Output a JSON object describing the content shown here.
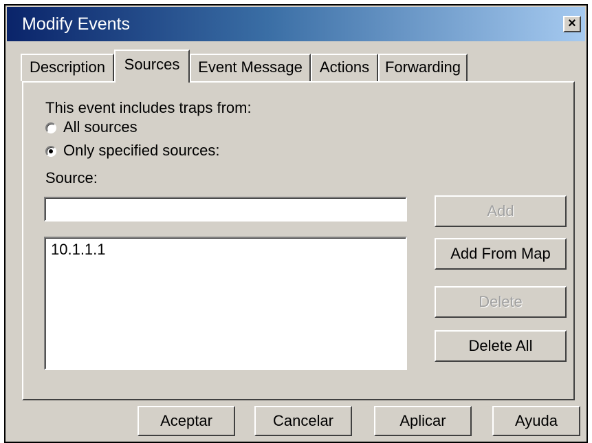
{
  "window": {
    "title": "Modify Events",
    "close_label": "×"
  },
  "tabs": [
    {
      "label": "Description",
      "active": false
    },
    {
      "label": "Sources",
      "active": true
    },
    {
      "label": "Event Message",
      "active": false
    },
    {
      "label": "Actions",
      "active": false
    },
    {
      "label": "Forwarding",
      "active": false
    }
  ],
  "sources": {
    "intro_label": "This event includes traps from:",
    "radio_all_label": "All sources",
    "radio_specified_label": "Only specified sources:",
    "selected_option": "Only specified sources:",
    "source_label": "Source:",
    "source_input_value": "",
    "list_items": [
      "10.1.1.1"
    ],
    "buttons": {
      "add": "Add",
      "add_from_map": "Add From Map",
      "delete": "Delete",
      "delete_all": "Delete All"
    }
  },
  "footer": {
    "ok": "Aceptar",
    "cancel": "Cancelar",
    "apply": "Aplicar",
    "help": "Ayuda"
  }
}
